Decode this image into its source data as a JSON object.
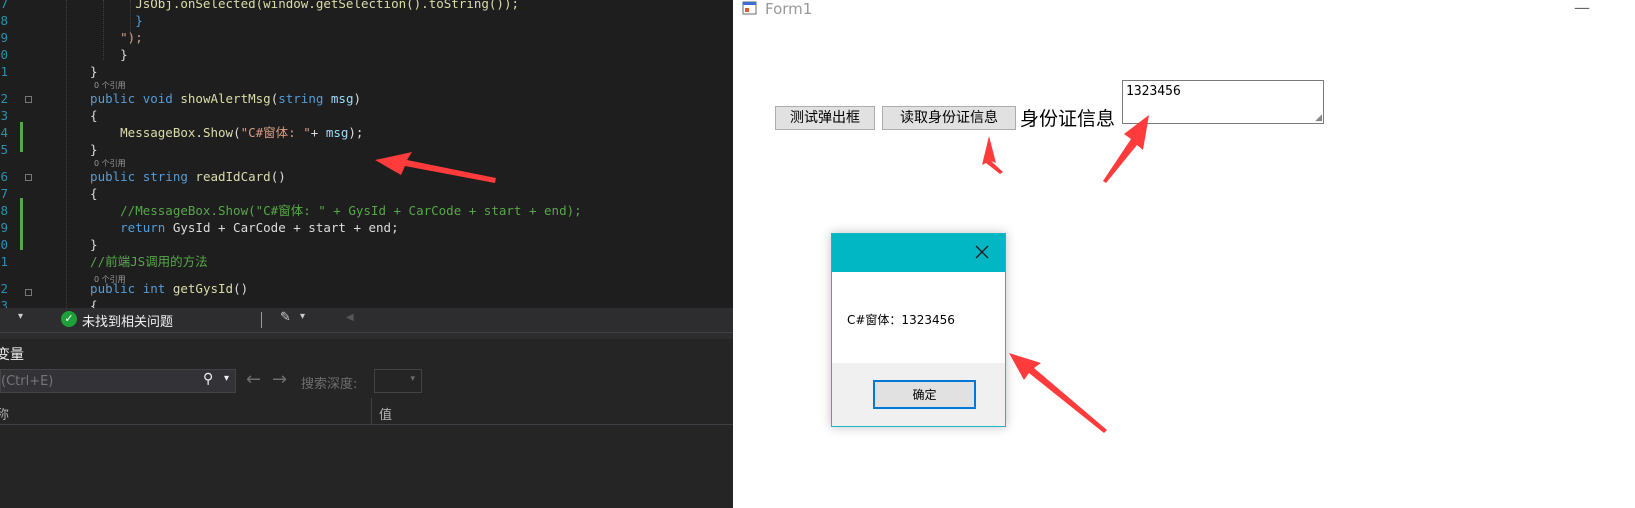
{
  "editor": {
    "lines": [
      {
        "num": "7",
        "parts": [
          {
            "t": "        JsObj.onSelected(window.getSelection().toString());",
            "c": "fn"
          }
        ]
      },
      {
        "num": "8",
        "parts": [
          {
            "t": "        }",
            "c": "kw"
          }
        ]
      },
      {
        "num": "9",
        "parts": [
          {
            "t": "      \");",
            "c": "str"
          }
        ]
      },
      {
        "num": "0",
        "parts": [
          {
            "t": "      }",
            "c": "id"
          }
        ]
      },
      {
        "num": "1",
        "parts": [
          {
            "t": "  }",
            "c": "id"
          }
        ]
      },
      {
        "num": "2",
        "parts": [
          {
            "t": "  public ",
            "c": "kw"
          },
          {
            "t": "void ",
            "c": "kw"
          },
          {
            "t": "showAlertMsg",
            "c": "fn"
          },
          {
            "t": "(",
            "c": "id"
          },
          {
            "t": "string ",
            "c": "kw"
          },
          {
            "t": "msg",
            "c": "prm"
          },
          {
            "t": ")",
            "c": "id"
          }
        ]
      },
      {
        "num": "3",
        "parts": [
          {
            "t": "  {",
            "c": "id"
          }
        ]
      },
      {
        "num": "4",
        "parts": [
          {
            "t": "      MessageBox",
            "c": "fn"
          },
          {
            "t": ".",
            "c": "id"
          },
          {
            "t": "Show",
            "c": "fn"
          },
          {
            "t": "(",
            "c": "id"
          },
          {
            "t": "\"C#窗体: \"",
            "c": "str"
          },
          {
            "t": "+ ",
            "c": "id"
          },
          {
            "t": "msg",
            "c": "prm"
          },
          {
            "t": ");",
            "c": "id"
          }
        ]
      },
      {
        "num": "5",
        "parts": [
          {
            "t": "  }",
            "c": "id"
          }
        ]
      },
      {
        "num": "6",
        "parts": [
          {
            "t": "  public ",
            "c": "kw"
          },
          {
            "t": "string ",
            "c": "kw"
          },
          {
            "t": "readIdCard",
            "c": "fn"
          },
          {
            "t": "()",
            "c": "id"
          }
        ]
      },
      {
        "num": "7",
        "parts": [
          {
            "t": "  {",
            "c": "id"
          }
        ]
      },
      {
        "num": "8",
        "parts": [
          {
            "t": "      //MessageBox.Show(\"C#窗体: \" + GysId + CarCode + start + end);",
            "c": "cmt"
          }
        ]
      },
      {
        "num": "9",
        "parts": [
          {
            "t": "      return ",
            "c": "kw"
          },
          {
            "t": "GysId + CarCode + start + end;",
            "c": "id"
          }
        ]
      },
      {
        "num": "0",
        "parts": [
          {
            "t": "  }",
            "c": "id"
          }
        ]
      },
      {
        "num": "1",
        "parts": [
          {
            "t": "  //前端JS调用的方法",
            "c": "cmt"
          }
        ]
      },
      {
        "num": "2",
        "parts": [
          {
            "t": "  public ",
            "c": "kw"
          },
          {
            "t": "int ",
            "c": "kw"
          },
          {
            "t": "getGysId",
            "c": "fn"
          },
          {
            "t": "()",
            "c": "id"
          }
        ]
      },
      {
        "num": "3",
        "parts": [
          {
            "t": "  {",
            "c": "id"
          }
        ]
      }
    ],
    "ref_hint": "0 个引用"
  },
  "statusbar": {
    "issues_text": "未找到相关问题"
  },
  "variables_panel": {
    "title": "变量",
    "search_placeholder": "(Ctrl+E)",
    "search_depth_label": "搜索深度:",
    "col_name": "称",
    "col_value": "值"
  },
  "form": {
    "title": "Form1",
    "test_button": "测试弹出框",
    "read_button": "读取身份证信息",
    "id_label": "身份证信息",
    "id_value": "1323456"
  },
  "dialog": {
    "message": "C#窗体：1323456",
    "ok_button": "确定"
  },
  "colors": {
    "dialog_title": "#00b7c3",
    "arrow": "#ff3b3b",
    "editor_bg": "#1e1e1e"
  }
}
